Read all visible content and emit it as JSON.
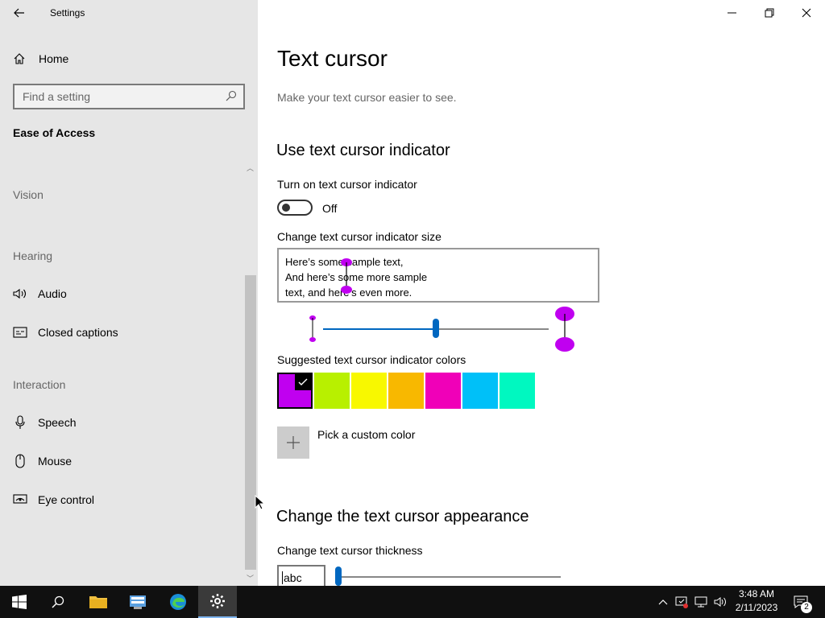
{
  "window": {
    "app_title": "Settings"
  },
  "sidebar": {
    "home_label": "Home",
    "search_placeholder": "Find a setting",
    "section_title": "Ease of Access",
    "groups": {
      "vision": "Vision",
      "hearing": "Hearing",
      "interaction": "Interaction"
    },
    "items": {
      "audio": "Audio",
      "closed_captions": "Closed captions",
      "speech": "Speech",
      "mouse": "Mouse",
      "eye_control": "Eye control"
    }
  },
  "main": {
    "title": "Text cursor",
    "description": "Make your text cursor easier to see.",
    "indicator_heading": "Use text cursor indicator",
    "toggle_label": "Turn on text cursor indicator",
    "toggle_state": "Off",
    "size_label": "Change text cursor indicator size",
    "sample_lines": [
      "Here’s some sample text,",
      "And here’s some more sample",
      "text, and here’s even more."
    ],
    "size_slider_value": 0.5,
    "colors_label": "Suggested text cursor indicator colors",
    "swatch_colors": [
      "#c000f0",
      "#b8f000",
      "#f8f800",
      "#f8b800",
      "#f000b8",
      "#00c0f8",
      "#00f8c0"
    ],
    "selected_swatch": 0,
    "custom_color_label": "Pick a custom color",
    "appearance_heading": "Change the text cursor appearance",
    "thickness_label": "Change text cursor thickness",
    "thickness_preview": "abc",
    "thickness_slider_value": 0.0
  },
  "taskbar": {
    "time": "3:48 AM",
    "date": "2/11/2023",
    "notification_count": "2"
  },
  "colors": {
    "accent": "#0067c0",
    "sidebar_bg": "#e6e6e6",
    "indicator": "#c000f0"
  }
}
